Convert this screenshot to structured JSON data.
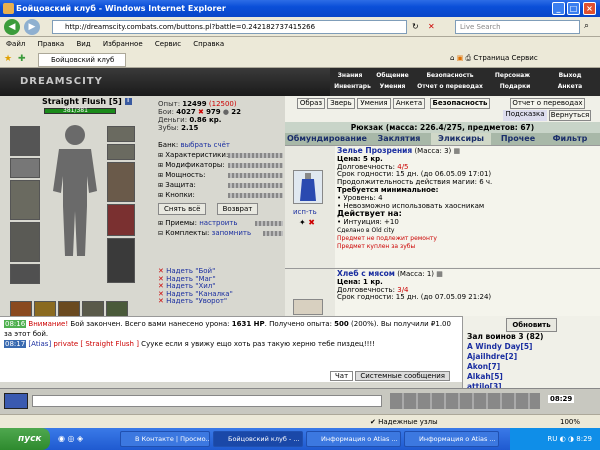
{
  "window": {
    "title": "Бойцовский клуб - Windows Internet Explorer"
  },
  "address": {
    "url": "http://dreamscity.combats.com/buttons.pl?battle=0.242182737415266",
    "search_placeholder": "Live Search"
  },
  "menu": [
    "Файл",
    "Правка",
    "Вид",
    "Избранное",
    "Сервис",
    "Справка"
  ],
  "tab": {
    "label": "Бойцовский клуб"
  },
  "toolbar": {
    "page": "Страница",
    "service": "Сервис"
  },
  "game": {
    "logo": "DREAMSCITY",
    "topnav_row1": [
      "Знания",
      "Общение",
      "Безопасность",
      "Персонаж",
      "Выход"
    ],
    "topnav_row2": [
      "Инвентарь",
      "Умения",
      "Отчет о переводах",
      "Подарки",
      "Анкета"
    ],
    "char": {
      "name": "Straight Flush",
      "level": "5",
      "hp": "381/381"
    },
    "stats": {
      "exp_label": "Опыт:",
      "exp": "12499",
      "exp_next": "(12500)",
      "battles_label": "Бои:",
      "wins": "4027",
      "losses": "979",
      "draws": "22",
      "money_label": "Деньги:",
      "money": "0.86 кр.",
      "teeth_label": "Зубы:",
      "teeth": "2.15"
    },
    "checks": {
      "bank": "Банк:",
      "bank_link": "выбрать счёт",
      "rows": [
        "Характеристики:",
        "Модификаторы:",
        "Мощность:",
        "Защита:",
        "Кнопки:"
      ],
      "undress": "Снять всё",
      "back": "Возврат",
      "moves": "Приемы:",
      "moves_link": "настроить",
      "sets": "Комплекты:",
      "sets_link": "запомнить"
    },
    "sets": [
      "Надеть \"Бой\"",
      "Надеть \"Маг\"",
      "Надеть \"Хил\"",
      "Надеть \"Каналка\"",
      "Надеть \"Уворот\""
    ],
    "right_buttons": [
      "Образ",
      "Зверь",
      "Умения",
      "Анкета",
      "Безопасность",
      "Отчет о переводах",
      "Подсказка",
      "Вернуться"
    ],
    "backpack": "Рюкзак (масса: 226.4/275, предметов: 67)",
    "tabs": [
      "Обмундирование",
      "Заклятия",
      "Эликсиры",
      "Прочее",
      "Фильтр"
    ],
    "items": [
      {
        "name": "Зелье Прозрения",
        "mass": "(Масса: 3)",
        "lines": [
          "Цена: 5 кр.",
          "Долговечность: 4/5",
          "Срок годности: 15 дн. (до 06.05.09 17:01)",
          "Продолжительность действия магии: 6 ч."
        ],
        "req_title": "Требуется минимальное:",
        "reqs": [
          "• Уровень: 4",
          "• Невозможно использовать хаосникам"
        ],
        "act_title": "Действует на:",
        "acts": [
          "• Интуиция: +10"
        ],
        "made": "Сделано в Old city",
        "notes": [
          "Предмет не подлежит ремонту",
          "Предмет куплен за зубы"
        ],
        "use_label": "исп-ть"
      },
      {
        "name": "Хлеб с мясом",
        "mass": "(Масса: 1)",
        "lines": [
          "Цена: 1 кр.",
          "Долговечность: 3/4",
          "Срок годности: 15 дн. (до 07.05.09 21:24)"
        ]
      }
    ]
  },
  "chat": {
    "line1_time": "08:16",
    "line1_warn": "Внимание!",
    "line1_text": " Бой закончен. Всего вами нанесено урона: ",
    "line1_hp": "1631 HP",
    "line1_text2": ". Получено опыта: ",
    "line1_exp": "500",
    "line1_text3": " (200%). Вы получили ",
    "line1_text4": "₽1.00 за этот бой.",
    "line2_time": "08:17",
    "line2_from": "[Atias]",
    "line2_private": "private [ Straight Flush ]",
    "line2_msg": " Сууке если я увижу ещо хоть раз такую херню тебе пиздец!!!!",
    "tab_chat": "Чат",
    "tab_sys": "Системные сообщения",
    "online_title": "Зал воинов 3 (82)",
    "refresh": "Обновить",
    "users": [
      "A Windy Day[5]",
      "Ajailhdre[2]",
      "Akon[7]",
      "Alkah[5]",
      "attilo[3]"
    ]
  },
  "clock": "08:29",
  "status": {
    "zone": "Надежные узлы",
    "zoom": "100%"
  },
  "taskbar": {
    "start": "пуск",
    "tasks": [
      "В Контакте | Просмо...",
      "Бойцовский клуб - ...",
      "Информация о Atias ...",
      "Информация о Atias ..."
    ],
    "lang": "RU",
    "time": "8:29"
  },
  "colors": {
    "titlebar": "#0a4fd8",
    "link": "#1a2ea0",
    "warn": "#c00000"
  }
}
